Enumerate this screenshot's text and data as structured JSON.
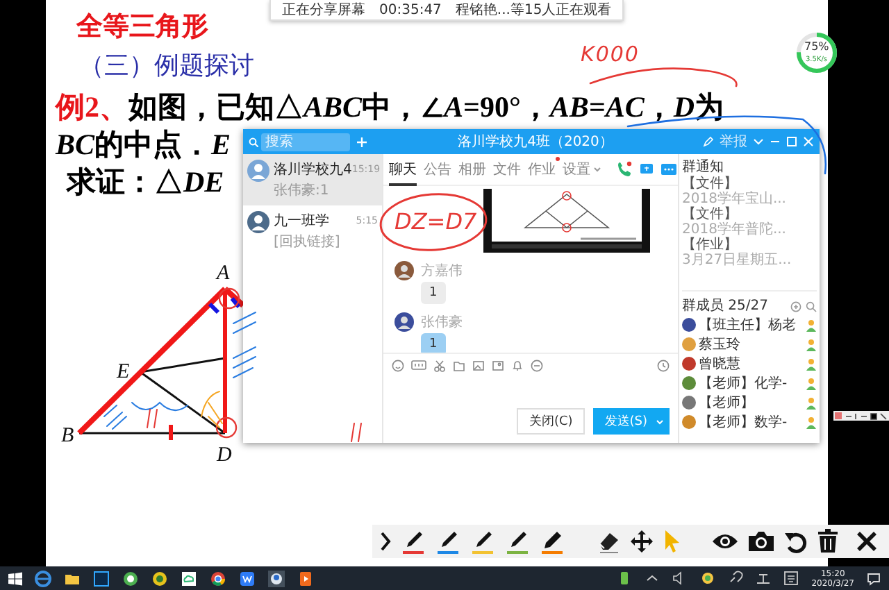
{
  "share_bar": {
    "status": "正在分享屏幕",
    "duration": "00:35:47",
    "viewers": "程铭艳...等15人正在观看"
  },
  "slide": {
    "title": "全等三角形",
    "section": "（三）例题探讨",
    "lines": [
      {
        "lead": "例2、",
        "indent": false,
        "segments": [
          {
            "text": "如图，已知△",
            "italic": false
          },
          {
            "text": "ABC",
            "italic": true
          },
          {
            "text": "中，∠",
            "italic": false
          },
          {
            "text": "A",
            "italic": true
          },
          {
            "text": "=90°，",
            "italic": false
          },
          {
            "text": "AB",
            "italic": true
          },
          {
            "text": "=",
            "italic": false
          },
          {
            "text": "AC",
            "italic": true
          },
          {
            "text": "，",
            "italic": false
          },
          {
            "text": "D",
            "italic": true
          },
          {
            "text": "为",
            "italic": false
          }
        ]
      },
      {
        "indent": false,
        "segments": [
          {
            "text": "BC",
            "italic": true
          },
          {
            "text": "的中点．",
            "italic": false
          },
          {
            "text": "E",
            "italic": true
          }
        ]
      },
      {
        "indent": true,
        "segments": [
          {
            "text": "求证：△",
            "italic": false
          },
          {
            "text": "DE",
            "italic": true
          }
        ]
      }
    ],
    "figure": {
      "points": [
        "A",
        "E",
        "B",
        "D"
      ]
    }
  },
  "handwriting": [
    "K000",
    "DZ=D7"
  ],
  "net_meter": {
    "reading": "75%",
    "speed": "3.5K/s",
    "level": 0.75
  },
  "chat_window": {
    "search": {
      "placeholder": "搜索"
    },
    "title": "洛川学校九4班（2020）",
    "report": "举报",
    "sessions": [
      {
        "name": "洛川学校九4",
        "time": "15:19",
        "preview": "张伟豪:1",
        "selected": true
      },
      {
        "name": "九一班学",
        "time": "5:15",
        "preview": "[回执链接]",
        "selected": false
      }
    ],
    "tabs": [
      {
        "label": "聊天",
        "selected": true,
        "notice": false
      },
      {
        "label": "公告",
        "selected": false,
        "notice": false
      },
      {
        "label": "相册",
        "selected": false,
        "notice": false
      },
      {
        "label": "文件",
        "selected": false,
        "notice": false
      },
      {
        "label": "作业",
        "selected": false,
        "notice": true
      },
      {
        "label": "设置",
        "selected": false,
        "notice": false
      }
    ],
    "messages": [
      {
        "kind": "image"
      },
      {
        "kind": "text",
        "sender": "方嘉伟",
        "text": "1",
        "color": "#ececec"
      },
      {
        "kind": "text",
        "sender": "张伟豪",
        "text": "1",
        "color": "#9ccff3"
      }
    ],
    "buttons": {
      "close": "关闭(C)",
      "send": "发送(S)"
    },
    "notices_title": "群通知",
    "notices": [
      {
        "tag": "【文件】",
        "text": "2018学年宝山..."
      },
      {
        "tag": "【文件】",
        "text": "2018学年普陀..."
      },
      {
        "tag": "【作业】",
        "text": "3月27日星期五..."
      }
    ],
    "members_title": "群成员 25/27",
    "members": [
      {
        "name": "【班主任】杨老"
      },
      {
        "name": "蔡玉玲"
      },
      {
        "name": "曾晓慧"
      },
      {
        "name": "【老师】化学-"
      },
      {
        "name": "【老师】"
      },
      {
        "name": "【老师】数学-"
      }
    ]
  },
  "pen_toolbar": {
    "tools": [
      {
        "kind": "pen",
        "color": "#e53935"
      },
      {
        "kind": "pen",
        "color": "#1e88e5"
      },
      {
        "kind": "pen",
        "color": "#f2c232"
      },
      {
        "kind": "pen",
        "color": "#7cb342"
      },
      {
        "kind": "marker",
        "color": "#f57c00"
      }
    ]
  },
  "taskbar": {
    "time": "15:20",
    "date": "2020/3/27"
  }
}
